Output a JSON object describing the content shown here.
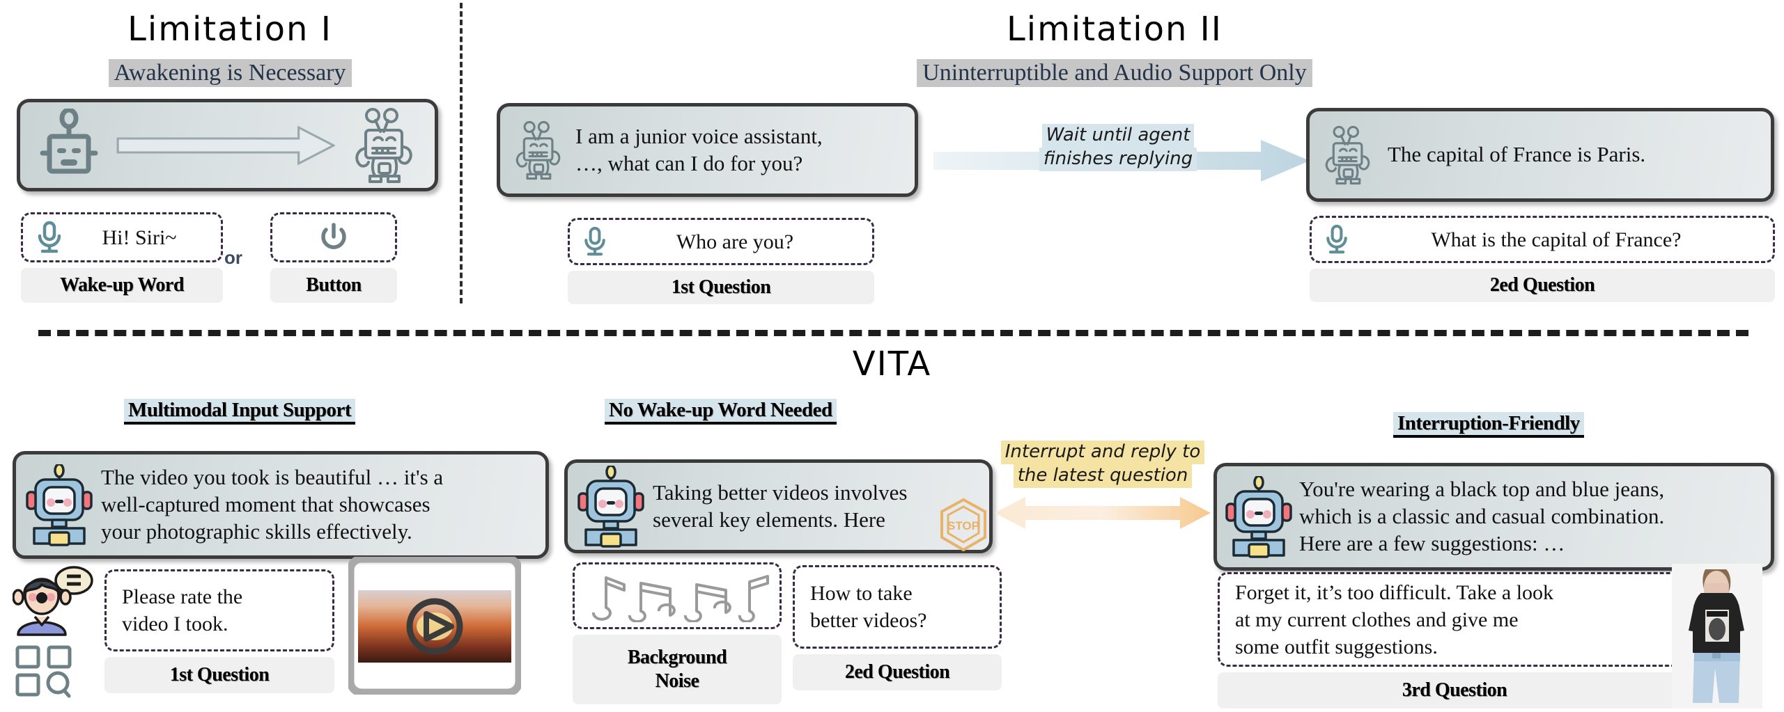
{
  "limitation1": {
    "title": "Limitation I",
    "subtitle": "Awakening is Necessary",
    "robot_sleep_icon": "robot-sleeping-icon",
    "arrow_icon": "right-arrow-icon",
    "robot_awake_icon": "robot-awake-icon",
    "wakeup": {
      "mic_icon": "microphone-icon",
      "text": "Hi! Siri~",
      "caption": "Wake-up Word"
    },
    "or_label": "or",
    "button": {
      "power_icon": "power-button-icon",
      "caption": "Button"
    }
  },
  "limitation2": {
    "title": "Limitation II",
    "subtitle": "Uninterruptible and Audio Support Only",
    "bubble1": {
      "robot_icon": "robot-awake-icon",
      "line1": "I am a junior voice assistant,",
      "line2": "…, what can I do for you?"
    },
    "question1": {
      "mic_icon": "microphone-icon",
      "text": "Who are you?",
      "caption": "1st Question"
    },
    "arrow_note_line1": "Wait until agent",
    "arrow_note_line2": "finishes replying",
    "arrow_icon": "right-arrow-icon",
    "bubble2": {
      "robot_icon": "robot-awake-icon",
      "text": "The capital of France is Paris."
    },
    "question2": {
      "mic_icon": "microphone-icon",
      "text": "What is the capital of France?",
      "caption": "2ed Question"
    }
  },
  "vita": {
    "title": "VITA",
    "headings": {
      "multimodal": "Multimodal Input Support",
      "nowakeup": "No Wake-up Word Needed",
      "interruption": "Interruption-Friendly"
    },
    "bubble1": {
      "robot_icon": "robot-avatar-icon",
      "line1": "The video you took is beautiful …  it's a",
      "line2": "well-captured moment that showcases",
      "line3": "your photographic skills effectively."
    },
    "question1": {
      "user_icon": "user-speaking-avatar-icon",
      "qr_icon": "qr-scan-icon",
      "line1": "Please rate the",
      "line2": "video I took.",
      "caption": "1st Question"
    },
    "video": {
      "film_icon": "film-strip-icon",
      "play_icon": "play-button-icon"
    },
    "bubble2": {
      "robot_icon": "robot-avatar-icon",
      "line1": "Taking better videos involves",
      "line2": "several key elements. Here",
      "stop_icon": "stop-sign-icon",
      "stop_label": "STOP"
    },
    "noise": {
      "notes_icon": "music-notes-icon",
      "caption_line1": "Background",
      "caption_line2": "Noise"
    },
    "question2": {
      "line1": "How to take",
      "line2": "better videos?",
      "caption": "2ed Question"
    },
    "arrow_note_line1": "Interrupt and reply to",
    "arrow_note_line2": "the latest question",
    "arrow_icon": "double-headed-arrow-icon",
    "bubble3": {
      "robot_icon": "robot-avatar-icon",
      "line1": "You're wearing a black top and blue jeans,",
      "line2": "which is a classic and casual combination.",
      "line3": "Here are a few suggestions:  …"
    },
    "question3": {
      "line1": "Forget it, it’s too difficult. Take a look",
      "line2": "at my current clothes and give me",
      "line3": "some outfit suggestions.",
      "caption": "3rd Question",
      "photo_icon": "person-photo-icon"
    }
  },
  "colors": {
    "highlight_grey": "#c6c6c6",
    "highlight_blue": "#d6e4ec",
    "highlight_yellow": "#f5e3a3",
    "bubble_border": "#3b3b3b",
    "dash_border": "#3b2a46",
    "mic_teal": "#5f8e99",
    "stop_orange": "#e8b26a",
    "arrow_blue": "#d5e5ec",
    "arrow_orange": "#f8d9b0"
  }
}
